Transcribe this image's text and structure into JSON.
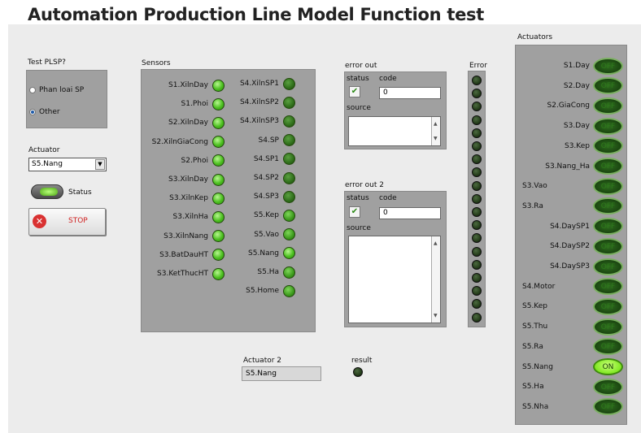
{
  "title": "Automation Production Line Model Function test",
  "test_plsp": {
    "label": "Test PLSP?",
    "options": [
      {
        "label": "Phan loai SP",
        "selected": false
      },
      {
        "label": "Other",
        "selected": true
      }
    ]
  },
  "actuator": {
    "label": "Actuator",
    "value": "S5.Nang"
  },
  "status": {
    "label": "Status"
  },
  "stop": {
    "label": "STOP"
  },
  "sensors": {
    "label": "Sensors",
    "col1": [
      {
        "name": "S1.XilnDay",
        "state": "bright"
      },
      {
        "name": "S1.Phoi",
        "state": "bright"
      },
      {
        "name": "S2.XilnDay",
        "state": "bright"
      },
      {
        "name": "S2.XilnGiaCong",
        "state": "bright"
      },
      {
        "name": "S2.Phoi",
        "state": "bright"
      },
      {
        "name": "S3.XilnDay",
        "state": "bright"
      },
      {
        "name": "S3.XilnKep",
        "state": "bright"
      },
      {
        "name": "S3.XilnHa",
        "state": "bright"
      },
      {
        "name": "S3.XilnNang",
        "state": "bright"
      },
      {
        "name": "S3.BatDauHT",
        "state": "bright"
      },
      {
        "name": "S3.KetThucHT",
        "state": "bright"
      }
    ],
    "col2": [
      {
        "name": "S4.XilnSP1",
        "state": "dim"
      },
      {
        "name": "S4.XilnSP2",
        "state": "dim"
      },
      {
        "name": "S4.XilnSP3",
        "state": "dim"
      },
      {
        "name": "S4.SP",
        "state": "dim"
      },
      {
        "name": "S4.SP1",
        "state": "dim"
      },
      {
        "name": "S4.SP2",
        "state": "dim"
      },
      {
        "name": "S4.SP3",
        "state": "dim"
      },
      {
        "name": "S5.Kep",
        "state": "mid"
      },
      {
        "name": "S5.Vao",
        "state": "mid"
      },
      {
        "name": "S5.Nang",
        "state": "bright"
      },
      {
        "name": "S5.Ha",
        "state": "mid"
      },
      {
        "name": "S5.Home",
        "state": "mid"
      }
    ]
  },
  "error_out": {
    "label": "error out",
    "status_label": "status",
    "code_label": "code",
    "code_value": "0",
    "source_label": "source",
    "check": "✔"
  },
  "error_out2": {
    "label": "error out 2",
    "status_label": "status",
    "code_label": "code",
    "code_value": "0",
    "source_label": "source",
    "check": "✔"
  },
  "error_column": {
    "label": "Error",
    "count": 19
  },
  "actuator2": {
    "label": "Actuator 2",
    "value": "S5.Nang"
  },
  "result": {
    "label": "result"
  },
  "actuators": {
    "label": "Actuators",
    "items": [
      {
        "name": "S1.Day",
        "align": "right",
        "state": "OFF"
      },
      {
        "name": "S2.Day",
        "align": "right",
        "state": "OFF"
      },
      {
        "name": "S2.GiaCong",
        "align": "right",
        "state": "OFF"
      },
      {
        "name": "S3.Day",
        "align": "right",
        "state": "OFF"
      },
      {
        "name": "S3.Kep",
        "align": "right",
        "state": "OFF"
      },
      {
        "name": "S3.Nang_Ha",
        "align": "right",
        "state": "OFF"
      },
      {
        "name": "S3.Vao",
        "align": "left",
        "state": "OFF"
      },
      {
        "name": "S3.Ra",
        "align": "left",
        "state": "OFF"
      },
      {
        "name": "S4.DaySP1",
        "align": "right",
        "state": "OFF"
      },
      {
        "name": "S4.DaySP2",
        "align": "right",
        "state": "OFF"
      },
      {
        "name": "S4.DaySP3",
        "align": "right",
        "state": "OFF"
      },
      {
        "name": "S4.Motor",
        "align": "left",
        "state": "OFF"
      },
      {
        "name": "S5.Kep",
        "align": "left",
        "state": "OFF"
      },
      {
        "name": "S5.Thu",
        "align": "left",
        "state": "OFF"
      },
      {
        "name": "S5.Ra",
        "align": "left",
        "state": "OFF"
      },
      {
        "name": "S5.Nang",
        "align": "left",
        "state": "ON"
      },
      {
        "name": "S5.Ha",
        "align": "left",
        "state": "OFF"
      },
      {
        "name": "S5.Nha",
        "align": "left",
        "state": "OFF"
      }
    ]
  }
}
